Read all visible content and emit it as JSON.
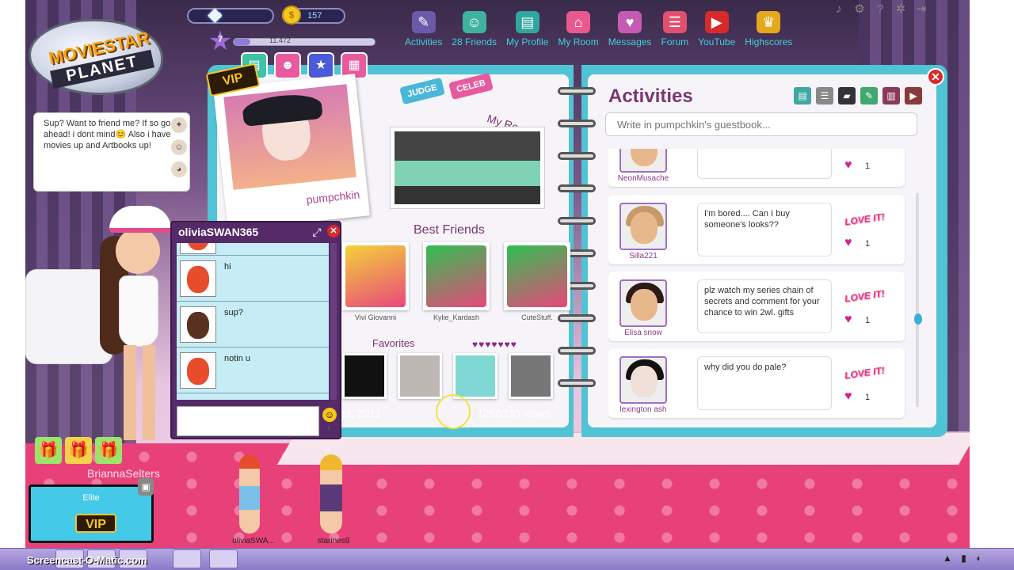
{
  "hud": {
    "diamonds": "0",
    "coins": "157",
    "level": "7",
    "fame": "11.472",
    "fame_progress": 0.12,
    "diamond_icon": "diamond-icon",
    "coin_icon": "coin-icon"
  },
  "logo": {
    "line1": "MOVIESTAR",
    "line2": "PLANET"
  },
  "nav": [
    {
      "label": "Activities",
      "icon": "activities-icon",
      "color": "#6a5aa8"
    },
    {
      "label": "28 Friends",
      "icon": "friends-icon",
      "color": "#3fb2a0"
    },
    {
      "label": "My Profile",
      "icon": "profile-icon",
      "color": "#2fa6a0"
    },
    {
      "label": "My Room",
      "icon": "room-icon",
      "color": "#e85a8e"
    },
    {
      "label": "Messages",
      "icon": "messages-icon",
      "color": "#c65ab2"
    },
    {
      "label": "Forum",
      "icon": "forum-icon",
      "color": "#e0506e"
    },
    {
      "label": "YouTube",
      "icon": "youtube-icon",
      "color": "#d82a2a"
    },
    {
      "label": "Highscores",
      "icon": "trophy-icon",
      "color": "#e3a81c"
    }
  ],
  "status_bubble": {
    "text": "Sup? Want to friend me? If so go ahead! i dont mind😊 Also i have movies up and Artbooks up!"
  },
  "player": {
    "username": "BriannaSelters",
    "vip_tier": "Elite",
    "vip_label": "VIP"
  },
  "profile": {
    "username": "pumpchkin",
    "vip_badge": "VIP",
    "tags": [
      "JUDGE",
      "CELEB"
    ],
    "my_room_label": "My Room",
    "best_friends_label": "Best Friends",
    "best_friends": [
      {
        "name": "Vivi Giovanni"
      },
      {
        "name": "Kylie_Kardash"
      },
      {
        "name": "CuteStuff."
      }
    ],
    "favorites_label": "Favorites",
    "date_fragment": "st, 2011",
    "views": "1258330 views"
  },
  "activities": {
    "title": "Activities",
    "guestbook_placeholder": "Write in pumpchkin's guestbook...",
    "entries": [
      {
        "user": "NeonMusache",
        "message": "",
        "love": "",
        "hearts": "1"
      },
      {
        "user": "Silla221",
        "message": "I'm bored.... Can I buy someone's looks??",
        "love": "LOVE IT!",
        "hearts": "1"
      },
      {
        "user": "Elisa snow",
        "message": "plz watch my series chain of secrets and comment for your chance to win 2wl. gifts",
        "love": "LOVE IT!",
        "hearts": "1"
      },
      {
        "user": "lexington ash",
        "message": "why did you do pale?",
        "love": "LOVE IT!",
        "hearts": "1"
      }
    ]
  },
  "chat": {
    "title": "oliviaSWAN365",
    "messages": [
      {
        "text": ""
      },
      {
        "text": "hi"
      },
      {
        "text": "sup?"
      },
      {
        "text": "notin u"
      }
    ]
  },
  "room_people": [
    {
      "name": "oliviaSWA..."
    },
    {
      "name": "starines9"
    }
  ],
  "taskbar": {
    "label": "Screencast-O-Matic.com"
  }
}
